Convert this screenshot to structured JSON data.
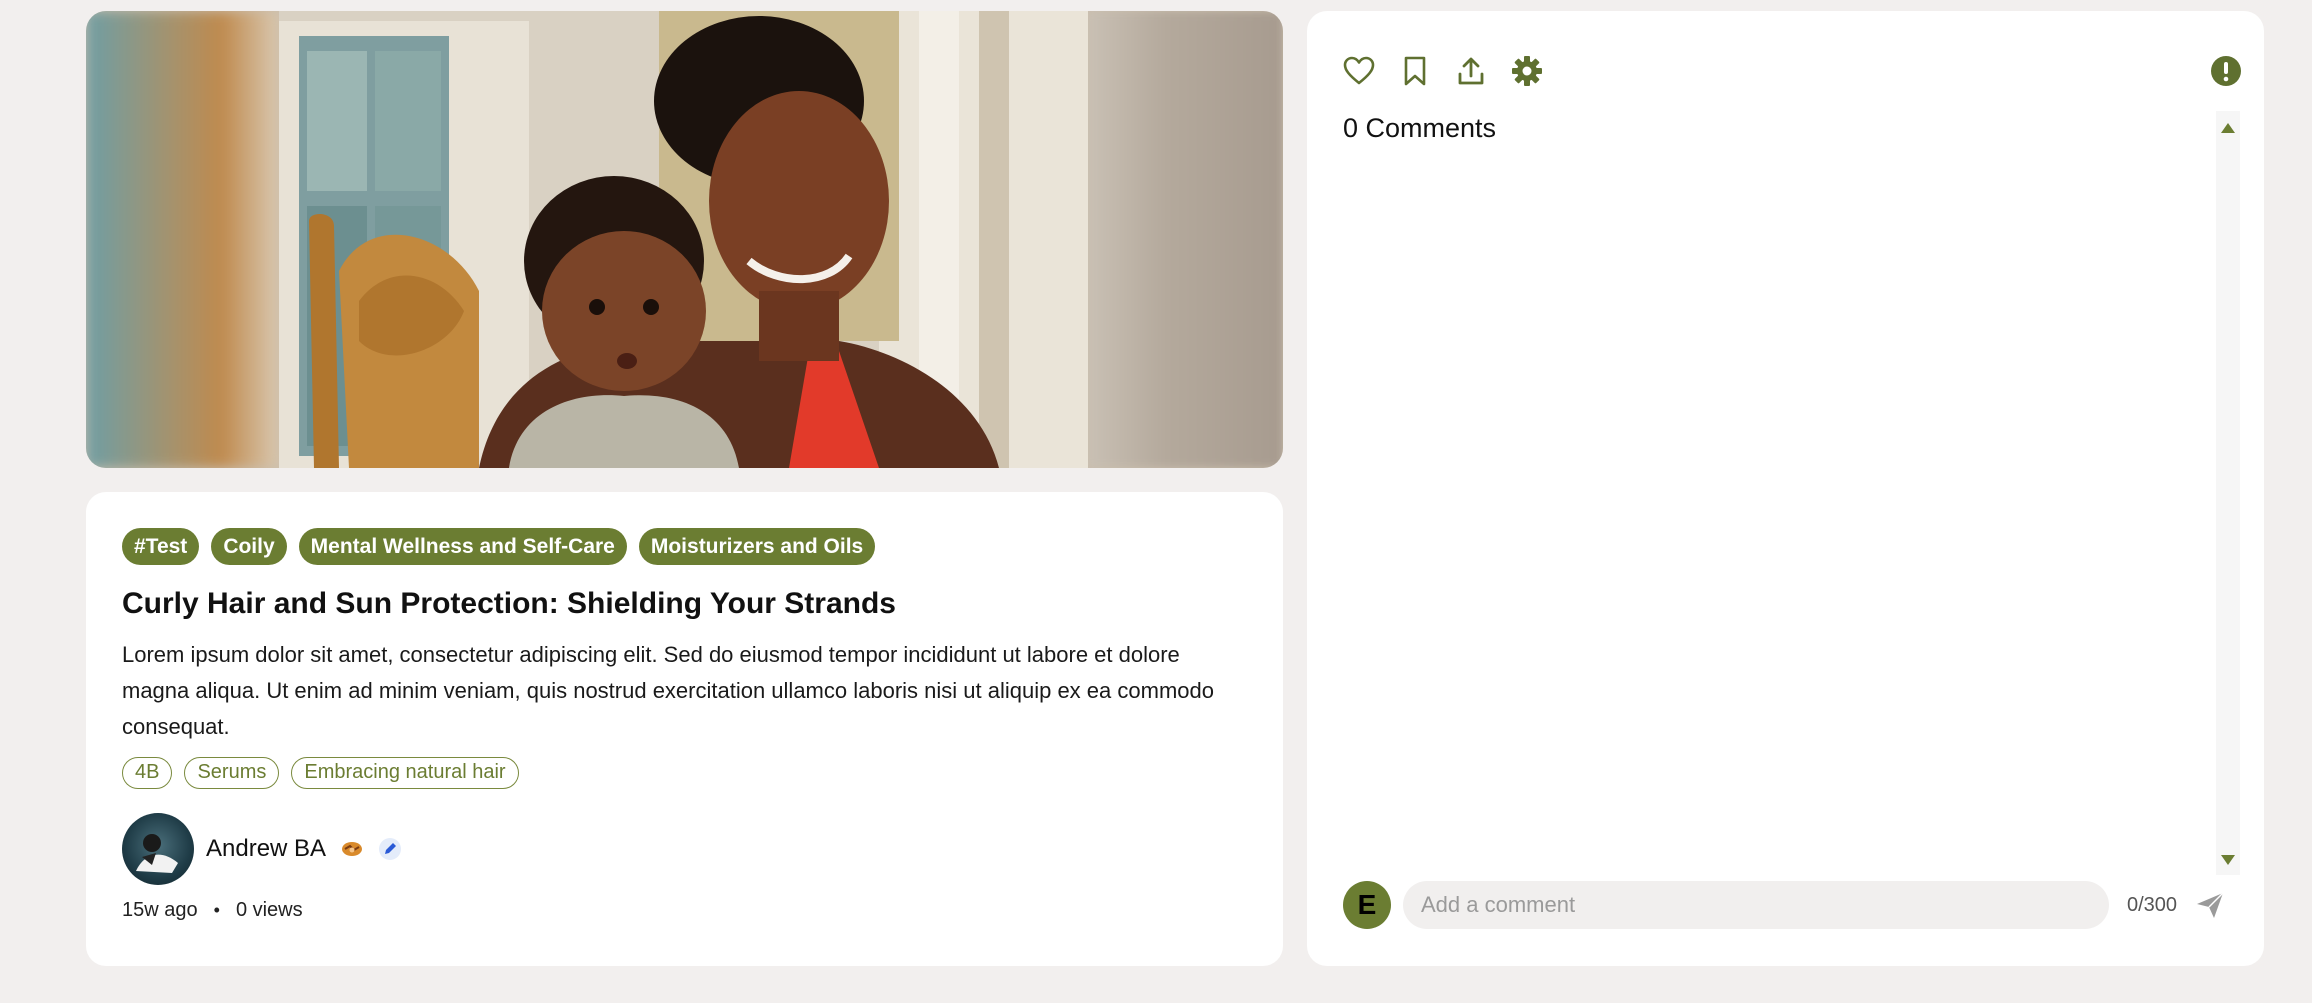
{
  "post": {
    "chips": [
      "#Test",
      "Coily",
      "Mental Wellness and Self-Care",
      "Moisturizers and Oils"
    ],
    "title": "Curly Hair and Sun Protection: Shielding Your Strands",
    "description": "Lorem ipsum dolor sit amet, consectetur adipiscing elit. Sed do eiusmod tempor incididunt ut labore et dolore magna aliqua. Ut enim ad minim veniam, quis nostrud exercitation ullamco laboris nisi ut aliquip ex ea commodo consequat.",
    "tags": [
      "4B",
      "Serums",
      "Embracing natural hair"
    ],
    "author": {
      "name": "Andrew BA"
    },
    "time_ago": "15w ago",
    "separator": "•",
    "views": "0 views"
  },
  "comments": {
    "count_label": "0 Comments",
    "user_initial": "E",
    "input_placeholder": "Add a comment",
    "char_counter": "0/300"
  },
  "colors": {
    "accent": "#6b7d32",
    "background": "#f2efee",
    "card": "#ffffff"
  },
  "icons": {
    "like": "heart-icon",
    "save": "bookmark-icon",
    "share": "share-icon",
    "settings": "gear-icon",
    "report": "alert-circle-icon",
    "send": "send-icon",
    "badge_1": "handshake-icon",
    "badge_2": "pencil-icon"
  }
}
